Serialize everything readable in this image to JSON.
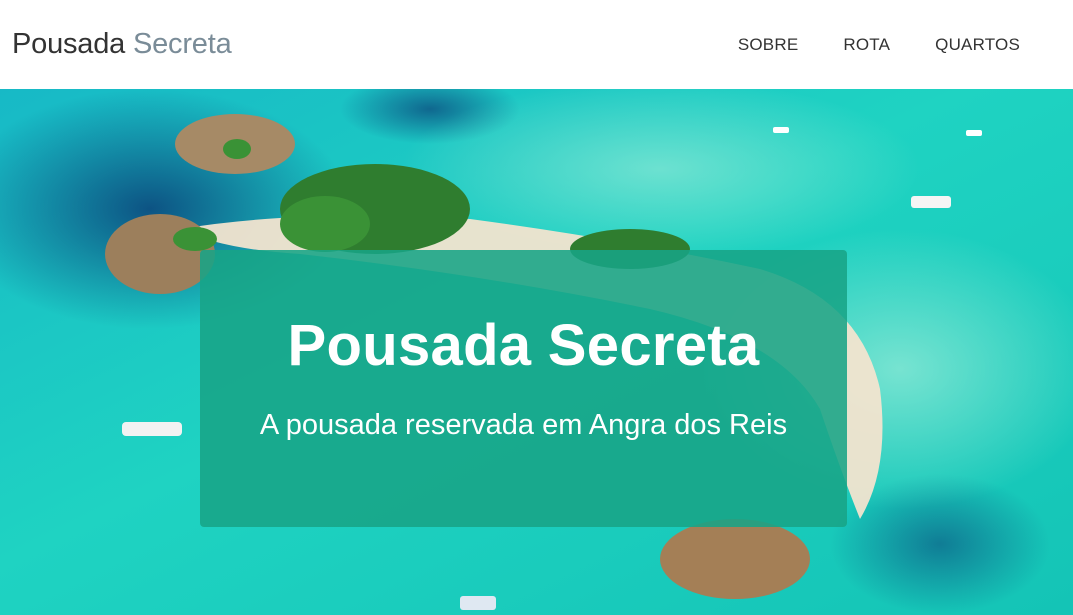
{
  "nav": {
    "brand_primary": "Pousada",
    "brand_secondary": "Secreta",
    "links": [
      {
        "label": "SOBRE"
      },
      {
        "label": "ROTA"
      },
      {
        "label": "QUARTOS"
      }
    ]
  },
  "hero": {
    "title": "Pousada Secreta",
    "subtitle": "A pousada reservada em Angra dos Reis"
  },
  "colors": {
    "brand_accent": "#7a8c98",
    "hero_box": "#18a486",
    "sea": "#1ccdbf"
  }
}
